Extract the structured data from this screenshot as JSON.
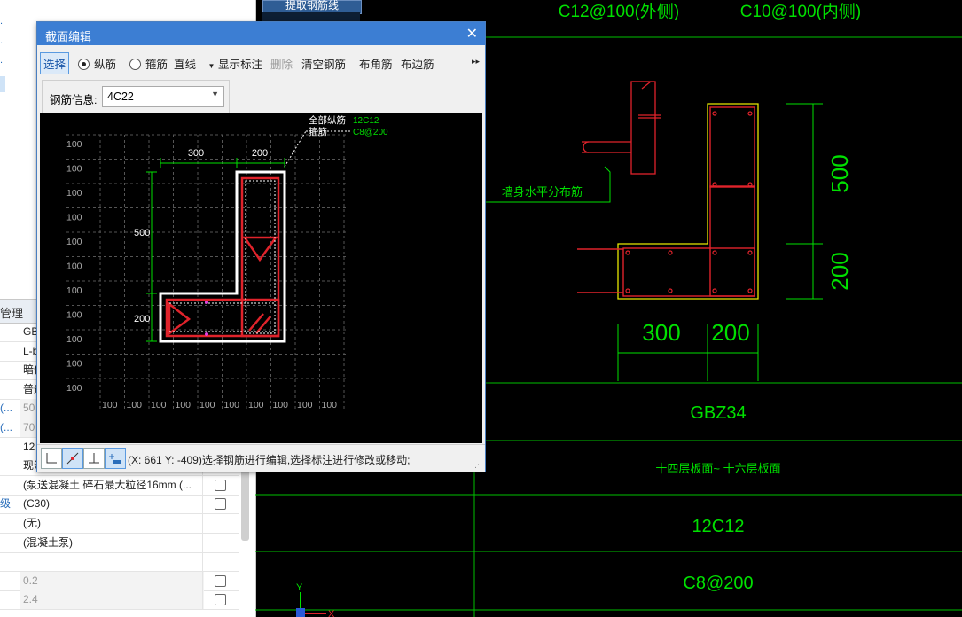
{
  "top_button": "提取钢筋线",
  "left": {
    "tab_label": "管理",
    "rows": [
      {
        "c1": "",
        "c2": "GB",
        "grey": false,
        "check": false
      },
      {
        "c1": "",
        "c2": "L-b",
        "grey": false,
        "check": false
      },
      {
        "c1": "",
        "c2": "暗住",
        "grey": false,
        "check": false
      },
      {
        "c1": "",
        "c2": "普通",
        "grey": false,
        "check": false
      },
      {
        "c1": "(...",
        "c2": "50",
        "grey": true,
        "check": false
      },
      {
        "c1": "(...",
        "c2": "70",
        "grey": true,
        "check": false
      },
      {
        "c1": "",
        "c2": "12",
        "grey": false,
        "check": false
      },
      {
        "c1": "",
        "c2": "现浇混凝土",
        "grey": false,
        "check": true
      },
      {
        "c1": "",
        "c2": "(泵送混凝土 碎石最大粒径16mm (...",
        "grey": false,
        "check": true
      },
      {
        "c1": "级",
        "c2": "(C30)",
        "grey": false,
        "check": true
      },
      {
        "c1": "",
        "c2": "(无)",
        "grey": false,
        "check": false
      },
      {
        "c1": "",
        "c2": "(混凝土泵)",
        "grey": false,
        "check": false
      },
      {
        "c1": "",
        "c2": "",
        "grey": false,
        "check": false
      },
      {
        "c1": "",
        "c2": "0.2",
        "grey": true,
        "check": true
      },
      {
        "c1": "",
        "c2": "2.4",
        "grey": true,
        "check": true
      }
    ]
  },
  "dialog": {
    "title": "截面编辑",
    "toolbar": {
      "select": "选择",
      "longitudinal": "纵筋",
      "stirrup": "箍筋",
      "line": "直线",
      "show_dims": "显示标注",
      "delete": "删除",
      "clear": "清空钢筋",
      "corner": "布角筋",
      "edge": "布边筋",
      "more": "▸▸"
    },
    "rebar_info_label": "钢筋信息:",
    "rebar_info_value": "4C22",
    "legend": {
      "all_long_label": "全部纵筋",
      "all_long_value": "12C12",
      "stirrup_label": "箍筋",
      "stirrup_value": "C8@200"
    },
    "dims": {
      "w1": "300",
      "w2": "200",
      "h1": "500",
      "h2": "200"
    },
    "grid_label": "100",
    "status": "(X: 661 Y: -409)选择钢筋进行编辑,选择标注进行修改或移动;"
  },
  "cad": {
    "header_left": "C12@100(外侧)",
    "header_right": "C10@100(内侧)",
    "note": "墙身水平分布筋",
    "dims": {
      "w1": "300",
      "w2": "200",
      "h1": "500",
      "h2": "200"
    },
    "label_gbz": "GBZ34",
    "label_floors": "十四层板面~ 十六层板面",
    "label_long": "12C12",
    "label_stirrup": "C8@200",
    "axis_y": "Y",
    "axis_x": "X"
  },
  "colors": {
    "green": "#00e000",
    "red": "#e0232b",
    "yellow": "#e8e800",
    "white": "#ffffff",
    "title_blue": "#3c7ed3"
  }
}
